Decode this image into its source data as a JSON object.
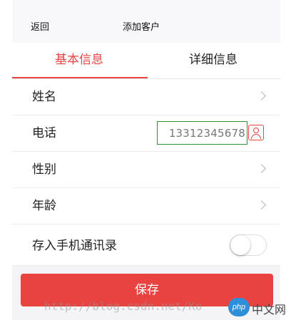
{
  "navbar": {
    "back_label": "返回",
    "title": "添加客户"
  },
  "tabs": [
    {
      "label": "基本信息",
      "active": true
    },
    {
      "label": "详细信息",
      "active": false
    }
  ],
  "form": {
    "name_label": "姓名",
    "phone_label": "电话",
    "phone_value": "13312345678",
    "gender_label": "性别",
    "age_label": "年龄",
    "save_contacts_label": "存入手机通讯录",
    "save_contacts_toggle": "off"
  },
  "save_button_label": "保存",
  "watermark_text": "http://blog.csdn.net/Ko",
  "brand_logo": {
    "badge": "php",
    "text": "中文网"
  },
  "colors": {
    "accent": "#e84340",
    "input_border": "#3a8f3a",
    "background": "#f4f4f7"
  },
  "icons": [
    "chevron-right-icon",
    "contact-icon",
    "toggle-switch"
  ]
}
